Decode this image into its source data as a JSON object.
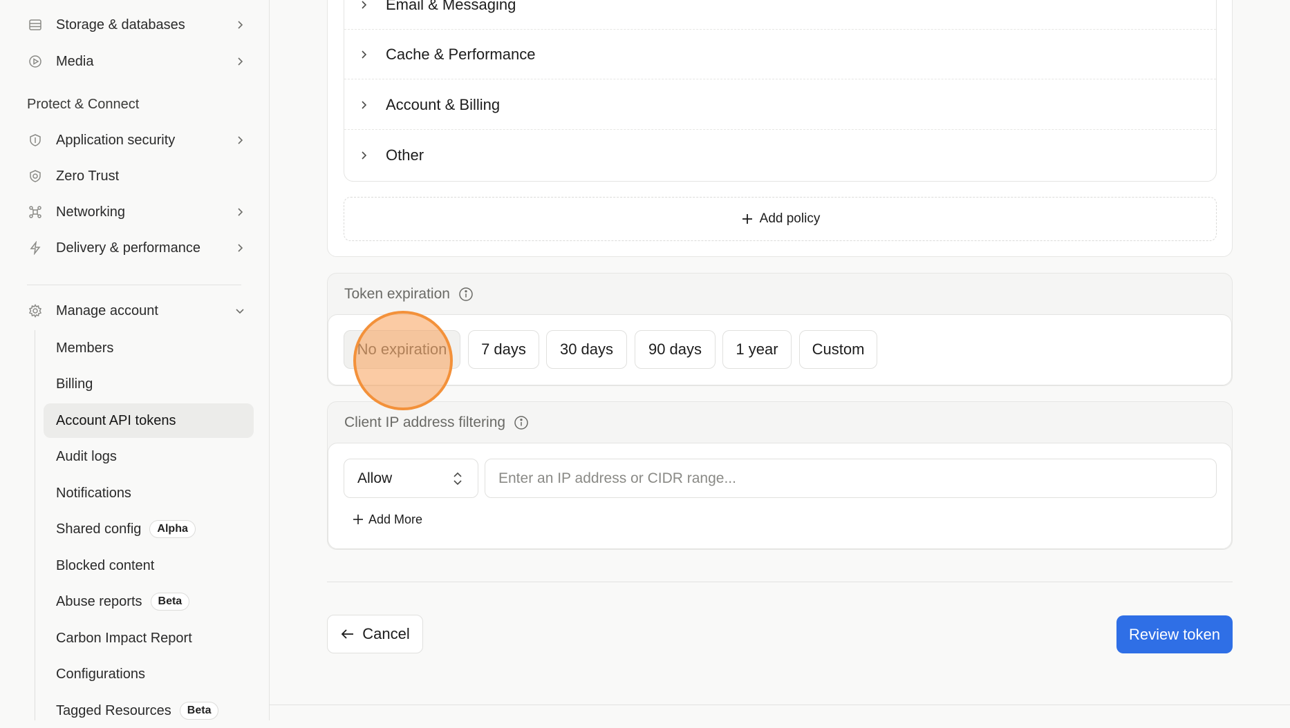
{
  "sidebar": {
    "top_items": [
      {
        "label": "Storage & databases",
        "icon": "database-icon"
      },
      {
        "label": "Media",
        "icon": "play-circle-icon"
      }
    ],
    "section_label": "Protect & Connect",
    "protect_items": [
      {
        "label": "Application security",
        "icon": "shield-icon"
      },
      {
        "label": "Zero Trust",
        "icon": "zero-trust-icon"
      },
      {
        "label": "Networking",
        "icon": "network-icon"
      },
      {
        "label": "Delivery & performance",
        "icon": "bolt-icon"
      }
    ],
    "manage_account": {
      "label": "Manage account",
      "icon": "gear-icon"
    },
    "sub_items": [
      {
        "label": "Members"
      },
      {
        "label": "Billing"
      },
      {
        "label": "Account API tokens"
      },
      {
        "label": "Audit logs"
      },
      {
        "label": "Notifications"
      },
      {
        "label": "Shared config",
        "badge": "Alpha"
      },
      {
        "label": "Blocked content"
      },
      {
        "label": "Abuse reports",
        "badge": "Beta"
      },
      {
        "label": "Carbon Impact Report"
      },
      {
        "label": "Configurations"
      },
      {
        "label": "Tagged Resources",
        "badge": "Beta"
      }
    ]
  },
  "policies": {
    "groups": [
      "Email & Messaging",
      "Cache & Performance",
      "Account & Billing",
      "Other"
    ],
    "add_label": "Add policy"
  },
  "token_expiration": {
    "title": "Token expiration",
    "options": [
      "No expiration",
      "7 days",
      "30 days",
      "90 days",
      "1 year",
      "Custom"
    ],
    "selected": "No expiration"
  },
  "ip_filtering": {
    "title": "Client IP address filtering",
    "mode": "Allow",
    "placeholder": "Enter an IP address or CIDR range...",
    "add_more": "Add More"
  },
  "footer": {
    "cancel": "Cancel",
    "review": "Review token"
  },
  "colors": {
    "primary": "#2f6fe6",
    "click_marker": "#f3913a"
  }
}
